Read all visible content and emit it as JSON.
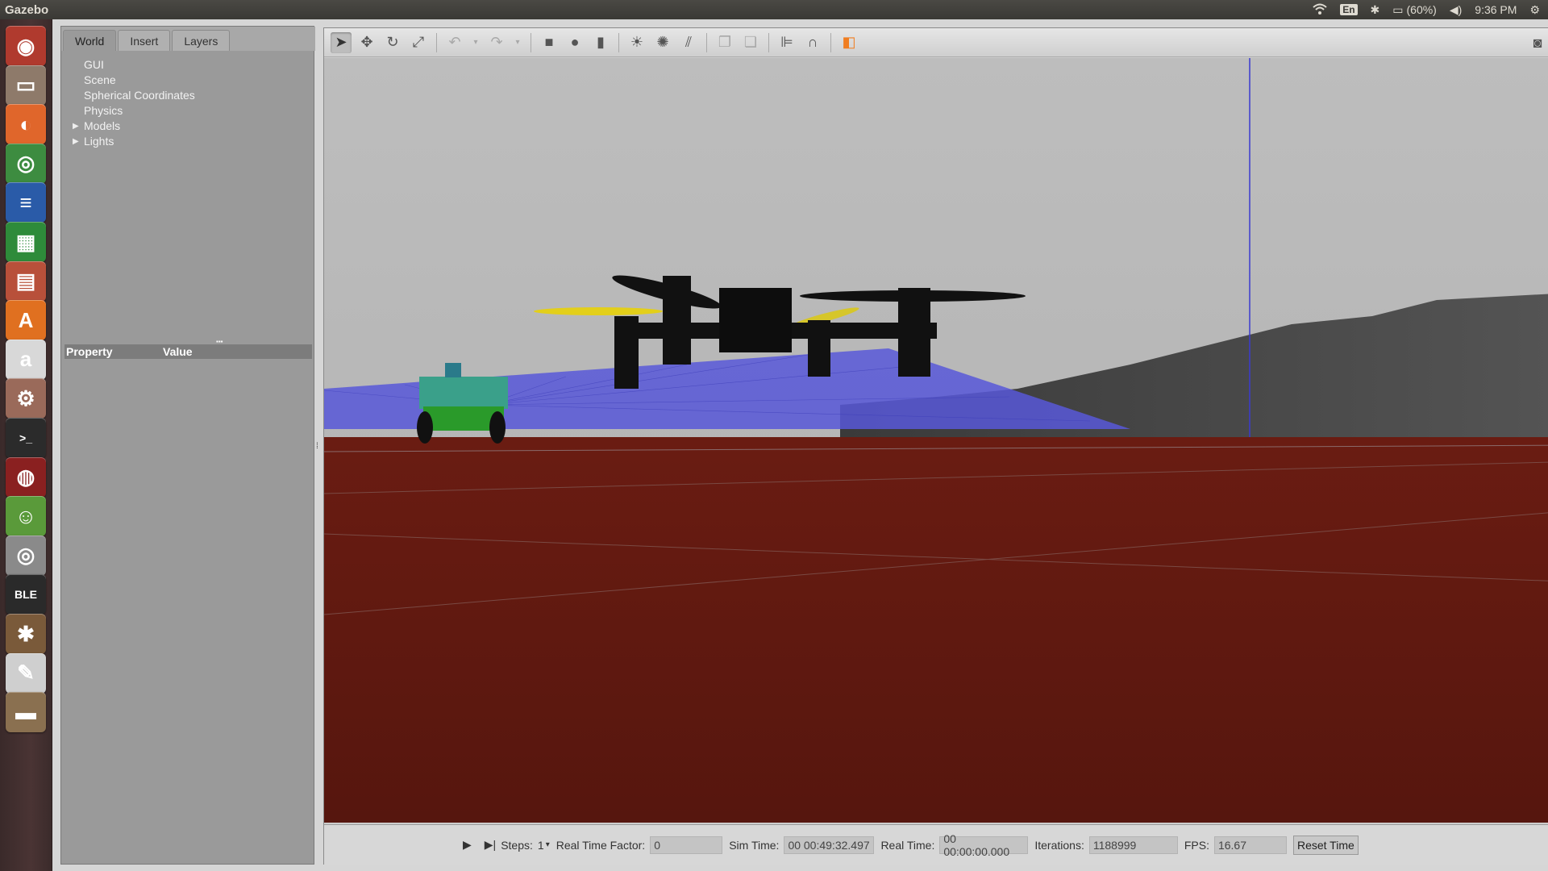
{
  "topbar": {
    "app_name": "Gazebo",
    "keyboard": "En",
    "battery": "(60%)",
    "clock": "9:36 PM",
    "icons": [
      "wifi-icon",
      "keyboard-layout-icon",
      "bluetooth-icon",
      "battery-icon",
      "volume-icon",
      "settings-gear-icon"
    ]
  },
  "launcher": {
    "items": [
      {
        "name": "ubuntu-dash-icon",
        "glyph": "◉",
        "color": "#b03a2e"
      },
      {
        "name": "files-icon",
        "glyph": "▭",
        "color": "#8e7a6a"
      },
      {
        "name": "firefox-icon",
        "glyph": "◐",
        "color": "#e0662b"
      },
      {
        "name": "chrome-icon",
        "glyph": "◎",
        "color": "#3d8c40"
      },
      {
        "name": "writer-icon",
        "glyph": "≡",
        "color": "#2a5ba8"
      },
      {
        "name": "calc-icon",
        "glyph": "▦",
        "color": "#2e8b3a"
      },
      {
        "name": "impress-icon",
        "glyph": "▤",
        "color": "#b8503a"
      },
      {
        "name": "software-center-icon",
        "glyph": "A",
        "color": "#e07020"
      },
      {
        "name": "amazon-icon",
        "glyph": "a",
        "color": "#d8d8d8"
      },
      {
        "name": "system-settings-icon",
        "glyph": "⚙",
        "color": "#9a6a5a"
      },
      {
        "name": "terminal-icon",
        "glyph": ">_",
        "color": "#2b2b2b"
      },
      {
        "name": "app-red-icon",
        "glyph": "◍",
        "color": "#8a2020"
      },
      {
        "name": "app-monkey-icon",
        "glyph": "☺",
        "color": "#5a9a3a"
      },
      {
        "name": "screenshot-icon",
        "glyph": "◎",
        "color": "#8a8a8a"
      },
      {
        "name": "app-ble-icon",
        "glyph": "BLE",
        "color": "#2a2a2a"
      },
      {
        "name": "app-drinks-icon",
        "glyph": "✱",
        "color": "#7a5a3a"
      },
      {
        "name": "text-editor-icon",
        "glyph": "✎",
        "color": "#cfcfcf"
      },
      {
        "name": "app-term-icon",
        "glyph": "▬",
        "color": "#8a7050"
      }
    ]
  },
  "leftpanel": {
    "tabs": [
      "World",
      "Insert",
      "Layers"
    ],
    "tree": [
      "GUI",
      "Scene",
      "Spherical Coordinates",
      "Physics",
      "Models",
      "Lights"
    ],
    "property_header": "Property",
    "value_header": "Value"
  },
  "toolbar": {
    "tools": [
      "select-arrow-icon",
      "translate-icon",
      "rotate-icon",
      "scale-icon",
      "undo-icon",
      "undo-dropdown-icon",
      "redo-icon",
      "redo-dropdown-icon",
      "box-icon",
      "sphere-icon",
      "cylinder-icon",
      "point-light-icon",
      "spot-light-icon",
      "directional-light-icon",
      "copy-icon",
      "paste-icon",
      "align-icon",
      "snap-icon",
      "view-angle-icon"
    ],
    "right": [
      "screenshot-camera-icon",
      "log-icon"
    ]
  },
  "bottombar": {
    "steps_label": "Steps:",
    "steps_value": "1",
    "rtf_label": "Real Time Factor:",
    "rtf_value": "0",
    "sim_label": "Sim Time:",
    "sim_value": "00 00:49:32.497",
    "real_label": "Real Time:",
    "real_value": "00 00:00:00.000",
    "iter_label": "Iterations:",
    "iter_value": "1188999",
    "fps_label": "FPS:",
    "fps_value": "16.67",
    "reset_label": "Reset Time"
  },
  "colors": {
    "ground": "#5a1a12",
    "sky": "#b9b9b9",
    "laser": "#4a4ad8",
    "accent": "#f07d20"
  }
}
